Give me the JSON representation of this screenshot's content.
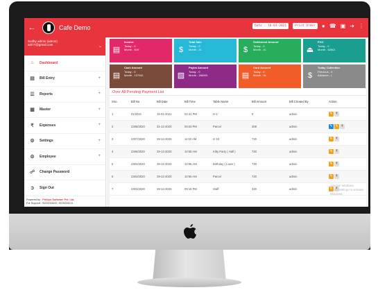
{
  "colors": {
    "brand": "#e8343d",
    "card_pink": "#e3286a",
    "card_cyan": "#26b8d6",
    "card_green": "#28ad5c",
    "card_teal": "#1a9e8f",
    "card_brown": "#7a4b3a",
    "card_purple": "#8d2b86",
    "card_orange": "#f25c28",
    "card_gray": "#8a8a8a"
  },
  "appbar": {
    "title": "Cafe Demo",
    "date": "Date : 16-01-2021",
    "print": "Print Order"
  },
  "user": {
    "line1": "Sudhy admin (admin)",
    "line2": "adt77@gmail.com"
  },
  "sidebar": {
    "items": [
      {
        "label": "Dashboard",
        "icon": "home-icon"
      },
      {
        "label": "Bill Entry",
        "icon": "receipt-icon",
        "plus": "+"
      },
      {
        "label": "Reports",
        "icon": "report-icon",
        "plus": "+"
      },
      {
        "label": "Master",
        "icon": "grid-icon",
        "plus": "+"
      },
      {
        "label": "Expenses",
        "icon": "expense-icon",
        "plus": "+"
      },
      {
        "label": "Settings",
        "icon": "gear-icon",
        "plus": "+"
      },
      {
        "label": "Employee",
        "icon": "employee-icon",
        "plus": "+"
      },
      {
        "label": "Change Password",
        "icon": "lock-icon"
      },
      {
        "label": "Sign Out",
        "icon": "signout-icon"
      }
    ],
    "powered_prefix": "Powered by :",
    "powered_company": "Prithyo Software Pvt. Ltd.",
    "support": "For Support : 9229233022, 9229233211"
  },
  "cards": [
    {
      "title": "Invoice",
      "l1": "Today - 0",
      "l2": "Month - 619",
      "icon": "invoice-icon"
    },
    {
      "title": "Total Sale",
      "l1": "Today - 0",
      "l2": "Month - 0/-",
      "icon": "dollar-icon"
    },
    {
      "title": "Settlement Amount",
      "l1": "Today - 0",
      "l2": "Month - 0/-",
      "icon": "settlement-icon"
    },
    {
      "title": "POC",
      "l1": "Today - 0",
      "l2": "Month - 6260/-",
      "icon": "eject-icon"
    },
    {
      "title": "Cash Amount",
      "l1": "Today - 0",
      "l2": "Month - 13740/-",
      "icon": "cash-icon"
    },
    {
      "title": "Paytm Amount",
      "l1": "Today - 0",
      "l2": "Month - 26690/-",
      "icon": "paytm-icon"
    },
    {
      "title": "Card Amount",
      "l1": "Today - 0",
      "l2": "Month - 0/-",
      "icon": "card-icon"
    },
    {
      "title": "Today Collection",
      "l1": "Previous - 0",
      "l2": "Advance - /-",
      "icon": "collection-icon"
    }
  ],
  "table": {
    "title": "Over All Pending Payment List",
    "headers": [
      "Sno.",
      "Bill No",
      "Bill Date",
      "Bill Time",
      "Table Name",
      "Bill Amount",
      "Bill Created By",
      "Action"
    ],
    "rows": [
      [
        "1",
        "01/2021",
        "16-01-2021",
        "04:41 PM",
        "H-1",
        "0",
        "admin"
      ],
      [
        "2",
        "2308/2020",
        "31-12-2020",
        "09:03 PM",
        "Parcel",
        "308",
        "admin"
      ],
      [
        "3",
        "2307/2020",
        "29-12-2020",
        "11:02 AM",
        "G-10",
        "720",
        "admin"
      ],
      [
        "4",
        "2306/2020",
        "29-12-2020",
        "10:58 AM",
        "Kitty Party ( Hall )",
        "720",
        "admin"
      ],
      [
        "5",
        "2304/2020",
        "29-12-2020",
        "10:56 AM",
        "Birthday ( Lawn )",
        "720",
        "admin"
      ],
      [
        "6",
        "2304/2020",
        "29-12-2020",
        "10:56 AM",
        "Parcel",
        "720",
        "admin"
      ],
      [
        "7",
        "2303/2020",
        "29-12-2020",
        "09:15 PM",
        "Staff",
        "340",
        "admin"
      ]
    ]
  },
  "watermark": {
    "l1": "Activate Windows",
    "l2": "Go to Settings to activate Windows."
  }
}
